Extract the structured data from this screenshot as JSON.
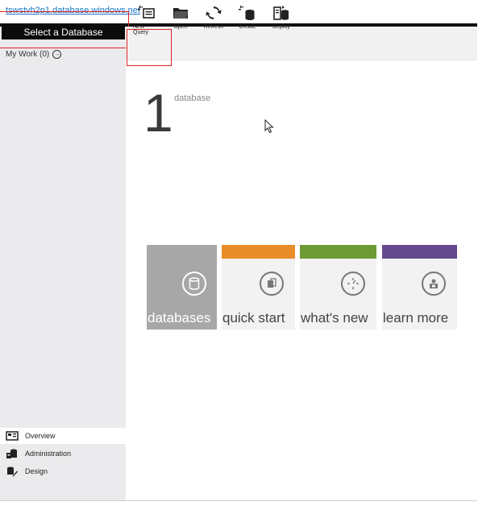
{
  "server": {
    "name": "tswstvh2p1.database.windows.net"
  },
  "sidebar": {
    "select_database": "Select a Database",
    "my_work": "My Work (0)",
    "nav": [
      {
        "label": "Overview",
        "icon": "overview-icon",
        "active": true
      },
      {
        "label": "Administration",
        "icon": "administration-icon",
        "active": false
      },
      {
        "label": "Design",
        "icon": "design-icon",
        "active": false
      }
    ]
  },
  "toolbar": {
    "items": [
      {
        "label": "New Query",
        "icon": "new-query-icon"
      },
      {
        "label": "Open",
        "icon": "folder-icon"
      },
      {
        "label": "Refresh",
        "icon": "refresh-icon"
      },
      {
        "label": "Create",
        "icon": "create-database-icon"
      },
      {
        "label": "Deploy",
        "icon": "deploy-icon"
      }
    ]
  },
  "summary": {
    "count": "1",
    "label": "database"
  },
  "tiles": [
    {
      "label": "databases",
      "icon": "database-icon",
      "color": "#a7a7a7"
    },
    {
      "label": "quick start",
      "icon": "quick-start-icon",
      "color": "#e98c2a"
    },
    {
      "label": "what's new",
      "icon": "whats-new-icon",
      "color": "#6e9a34"
    },
    {
      "label": "learn more",
      "icon": "learn-more-icon",
      "color": "#64498c"
    }
  ],
  "colors": {
    "highlight": "#e01f25",
    "link": "#1a73c9"
  }
}
